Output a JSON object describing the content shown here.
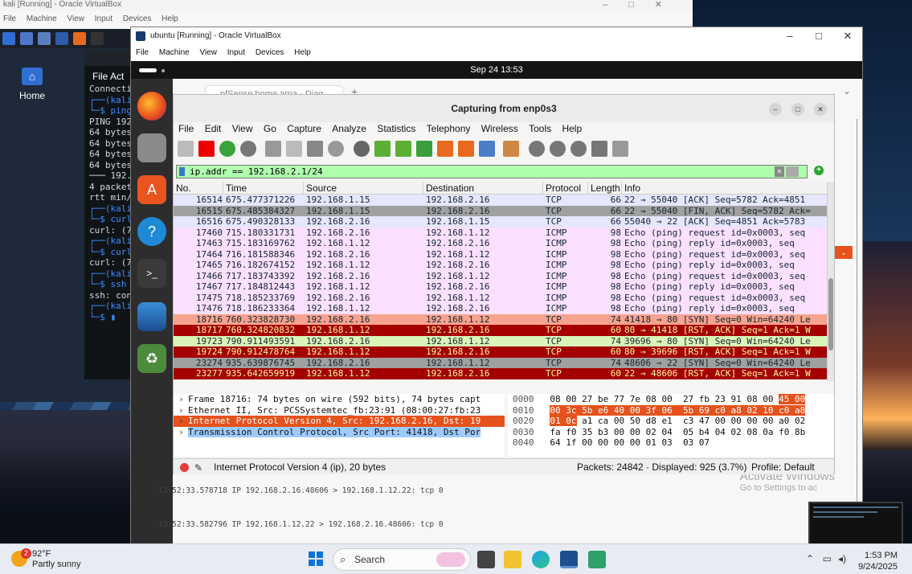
{
  "kali_vm": {
    "title": "kali [Running] - Oracle VirtualBox",
    "menu": [
      "File",
      "Machine",
      "View",
      "Input",
      "Devices",
      "Help"
    ],
    "home_label": "Home",
    "terminal_menu": "File  Act",
    "terminal_lines": [
      "Connecti",
      "┌──(kali",
      "└─$ ping",
      "PING 192",
      "64 bytes",
      "64 bytes",
      "64 bytes",
      "64 bytes",
      "",
      "─── 192.",
      "4 packet",
      "rtt min/",
      "",
      "┌──(kali",
      "└─$ curl",
      "curl: (7",
      "",
      "┌──(kali",
      "└─$ curl",
      "curl: (7",
      "",
      "┌──(kali",
      "└─$ ssh ",
      "ssh: con",
      "",
      "┌──(kali",
      "└─$ ▮"
    ]
  },
  "ubuntu_vm": {
    "title": "ubuntu [Running] - Oracle VirtualBox",
    "menu": [
      "File",
      "Machine",
      "View",
      "Input",
      "Devices",
      "Help"
    ],
    "gnome_clock": "Sep 24  13:53",
    "browser_tab": "pfSense.home.arpa - Diag",
    "tcpdump_lines": [
      "13:52:33.578718 IP 192.168.2.16.48606 > 192.168.1.12.22: tcp 0",
      "13:52:33.582796 IP 192.168.1.12.22 > 192.168.2.16.48606: tcp 0"
    ],
    "activate_title": "Activate Windows",
    "activate_sub": "Go to Settings to ac"
  },
  "wireshark": {
    "title": "Capturing from enp0s3",
    "menu": [
      "File",
      "Edit",
      "View",
      "Go",
      "Capture",
      "Analyze",
      "Statistics",
      "Telephony",
      "Wireless",
      "Tools",
      "Help"
    ],
    "filter": "ip.addr == 192.168.2.1/24",
    "columns": [
      "No.",
      "Time",
      "Source",
      "Destination",
      "Protocol",
      "Length",
      "Info"
    ],
    "packets": [
      {
        "no": "16514",
        "time": "675.477371226",
        "src": "192.168.1.15",
        "dst": "192.168.2.16",
        "proto": "TCP",
        "len": "66",
        "info": "22 → 55040 [ACK] Seq=5782 Ack=4851 ",
        "bg": "#e7e6ff",
        "fg": "#12272e"
      },
      {
        "no": "16515",
        "time": "675.485384327",
        "src": "192.168.1.15",
        "dst": "192.168.2.16",
        "proto": "TCP",
        "len": "66",
        "info": "22 → 55040 [FIN, ACK] Seq=5782 Ack=",
        "bg": "#a0a0a0",
        "fg": "#12272e"
      },
      {
        "no": "16516",
        "time": "675.490328133",
        "src": "192.168.2.16",
        "dst": "192.168.1.15",
        "proto": "TCP",
        "len": "66",
        "info": "55040 → 22 [ACK] Seq=4851 Ack=5783 ",
        "bg": "#e7e6ff",
        "fg": "#12272e"
      },
      {
        "no": "17460",
        "time": "715.180331731",
        "src": "192.168.2.16",
        "dst": "192.168.1.12",
        "proto": "ICMP",
        "len": "98",
        "info": "Echo (ping) request  id=0x0003, seq",
        "bg": "#fce0ff",
        "fg": "#12272e"
      },
      {
        "no": "17463",
        "time": "715.183169762",
        "src": "192.168.1.12",
        "dst": "192.168.2.16",
        "proto": "ICMP",
        "len": "98",
        "info": "Echo (ping) reply    id=0x0003, seq",
        "bg": "#fce0ff",
        "fg": "#12272e"
      },
      {
        "no": "17464",
        "time": "716.181588346",
        "src": "192.168.2.16",
        "dst": "192.168.1.12",
        "proto": "ICMP",
        "len": "98",
        "info": "Echo (ping) request  id=0x0003, seq",
        "bg": "#fce0ff",
        "fg": "#12272e"
      },
      {
        "no": "17465",
        "time": "716.182674152",
        "src": "192.168.1.12",
        "dst": "192.168.2.16",
        "proto": "ICMP",
        "len": "98",
        "info": "Echo (ping) reply    id=0x0003, seq",
        "bg": "#fce0ff",
        "fg": "#12272e"
      },
      {
        "no": "17466",
        "time": "717.183743392",
        "src": "192.168.2.16",
        "dst": "192.168.1.12",
        "proto": "ICMP",
        "len": "98",
        "info": "Echo (ping) request  id=0x0003, seq",
        "bg": "#fce0ff",
        "fg": "#12272e"
      },
      {
        "no": "17467",
        "time": "717.184812443",
        "src": "192.168.1.12",
        "dst": "192.168.2.16",
        "proto": "ICMP",
        "len": "98",
        "info": "Echo (ping) reply    id=0x0003, seq",
        "bg": "#fce0ff",
        "fg": "#12272e"
      },
      {
        "no": "17475",
        "time": "718.185233769",
        "src": "192.168.2.16",
        "dst": "192.168.1.12",
        "proto": "ICMP",
        "len": "98",
        "info": "Echo (ping) request  id=0x0003, seq",
        "bg": "#fce0ff",
        "fg": "#12272e"
      },
      {
        "no": "17476",
        "time": "718.186233364",
        "src": "192.168.1.12",
        "dst": "192.168.2.16",
        "proto": "ICMP",
        "len": "98",
        "info": "Echo (ping) reply    id=0x0003, seq",
        "bg": "#fce0ff",
        "fg": "#12272e"
      },
      {
        "no": "18716",
        "time": "760.323828730",
        "src": "192.168.2.16",
        "dst": "192.168.1.12",
        "proto": "TCP",
        "len": "74",
        "info": "41418 → 80 [SYN] Seq=0 Win=64240 Le",
        "bg": "#f6a38f",
        "fg": "#12272e"
      },
      {
        "no": "18717",
        "time": "760.324820832",
        "src": "192.168.1.12",
        "dst": "192.168.2.16",
        "proto": "TCP",
        "len": "60",
        "info": "80 → 41418 [RST, ACK] Seq=1 Ack=1 W",
        "bg": "#a40000",
        "fg": "#fffc9c"
      },
      {
        "no": "19723",
        "time": "790.911493591",
        "src": "192.168.2.16",
        "dst": "192.168.1.12",
        "proto": "TCP",
        "len": "74",
        "info": "39696 → 80 [SYN] Seq=0 Win=64240 Le",
        "bg": "#daf5b9",
        "fg": "#12272e"
      },
      {
        "no": "19724",
        "time": "790.912478764",
        "src": "192.168.1.12",
        "dst": "192.168.2.16",
        "proto": "TCP",
        "len": "60",
        "info": "80 → 39696 [RST, ACK] Seq=1 Ack=1 W",
        "bg": "#a40000",
        "fg": "#fffc9c"
      },
      {
        "no": "23274",
        "time": "935.639876745",
        "src": "192.168.2.16",
        "dst": "192.168.1.12",
        "proto": "TCP",
        "len": "74",
        "info": "48606 → 22 [SYN] Seq=0 Win=64240 Le",
        "bg": "#a0a0a0",
        "fg": "#12272e"
      },
      {
        "no": "23277",
        "time": "935.642659919",
        "src": "192.168.1.12",
        "dst": "192.168.2.16",
        "proto": "TCP",
        "len": "60",
        "info": "22 → 48606 [RST, ACK] Seq=1 Ack=1 W",
        "bg": "#a40000",
        "fg": "#fffc9c"
      }
    ],
    "details": [
      {
        "text": "Frame 18716: 74 bytes on wire (592 bits), 74 bytes capt",
        "style": "normal"
      },
      {
        "text": "Ethernet II, Src: PCSSystemtec_fb:23:91 (08:00:27:fb:23",
        "style": "normal"
      },
      {
        "text": "Internet Protocol Version 4, Src: 192.168.2.16, Dst: 19",
        "style": "ip"
      },
      {
        "text": "Transmission Control Protocol, Src Port: 41418, Dst Por",
        "style": "tcp"
      }
    ],
    "hex": [
      {
        "off": "0000",
        "bytes": "08 00 27 be 77 7e 08 00  27 fb 23 91 08 00",
        "hl": "45 00"
      },
      {
        "off": "0010",
        "pre": "",
        "bytes": "00 3c 5b e6 40 00 3f 06  5b 69 c0 a8 02 10 c0 a8",
        "hl_all": true
      },
      {
        "off": "0020",
        "hlpre": "01 0c",
        "bytes": " a1 ca 00 50 d8 e1  c3 47 00 00 00 00 a0 02"
      },
      {
        "off": "0030",
        "bytes": "fa f0 35 b3 00 00 02 04  05 b4 04 02 08 0a f0 8b"
      },
      {
        "off": "0040",
        "bytes": "64 1f 00 00 00 00 01 03  03 07"
      }
    ],
    "status_left": "Internet Protocol Version 4 (ip), 20 bytes",
    "status_packets": "Packets: 24842 · Displayed: 925 (3.7%)",
    "status_profile": "Profile: Default"
  },
  "taskbar": {
    "temp": "92°F",
    "weather": "Partly sunny",
    "badge": "2",
    "search_placeholder": "Search",
    "time": "1:53 PM",
    "date": "9/24/2025"
  }
}
